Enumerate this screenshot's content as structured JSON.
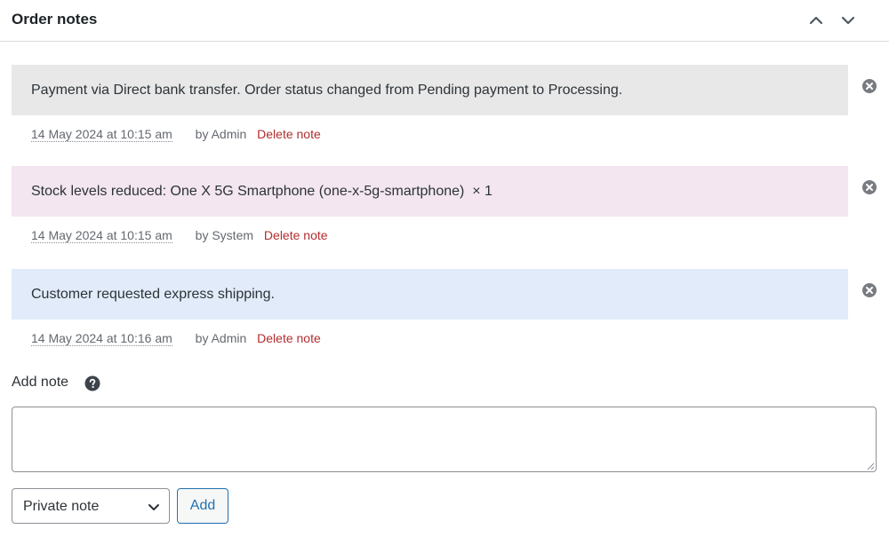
{
  "panel": {
    "title": "Order notes",
    "collapse_up_icon": "chevron-up-icon",
    "collapse_down_icon": "chevron-down-icon"
  },
  "notes": [
    {
      "text": "Payment via Direct bank transfer. Order status changed from Pending payment to Processing.",
      "date": "14 May 2024 at 10:15 am",
      "author": "by Admin",
      "delete_label": "Delete note",
      "background": "#e8e8e8"
    },
    {
      "text": "Stock levels reduced: One X 5G Smartphone (one-x-5g-smartphone)  × 1",
      "date": "14 May 2024 at 10:15 am",
      "author": "by System",
      "delete_label": "Delete note",
      "background": "#f3e6f0"
    },
    {
      "text": "Customer requested express shipping.",
      "date": "14 May 2024 at 10:16 am",
      "author": "by Admin",
      "delete_label": "Delete note",
      "background": "#e1ebfa"
    }
  ],
  "add_note": {
    "label": "Add note",
    "help_icon": "question-circle-icon",
    "textarea_value": "",
    "note_type_selected": "Private note",
    "add_button_label": "Add"
  },
  "colors": {
    "delete_link": "#b32d2e",
    "button_accent": "#2271b1"
  }
}
